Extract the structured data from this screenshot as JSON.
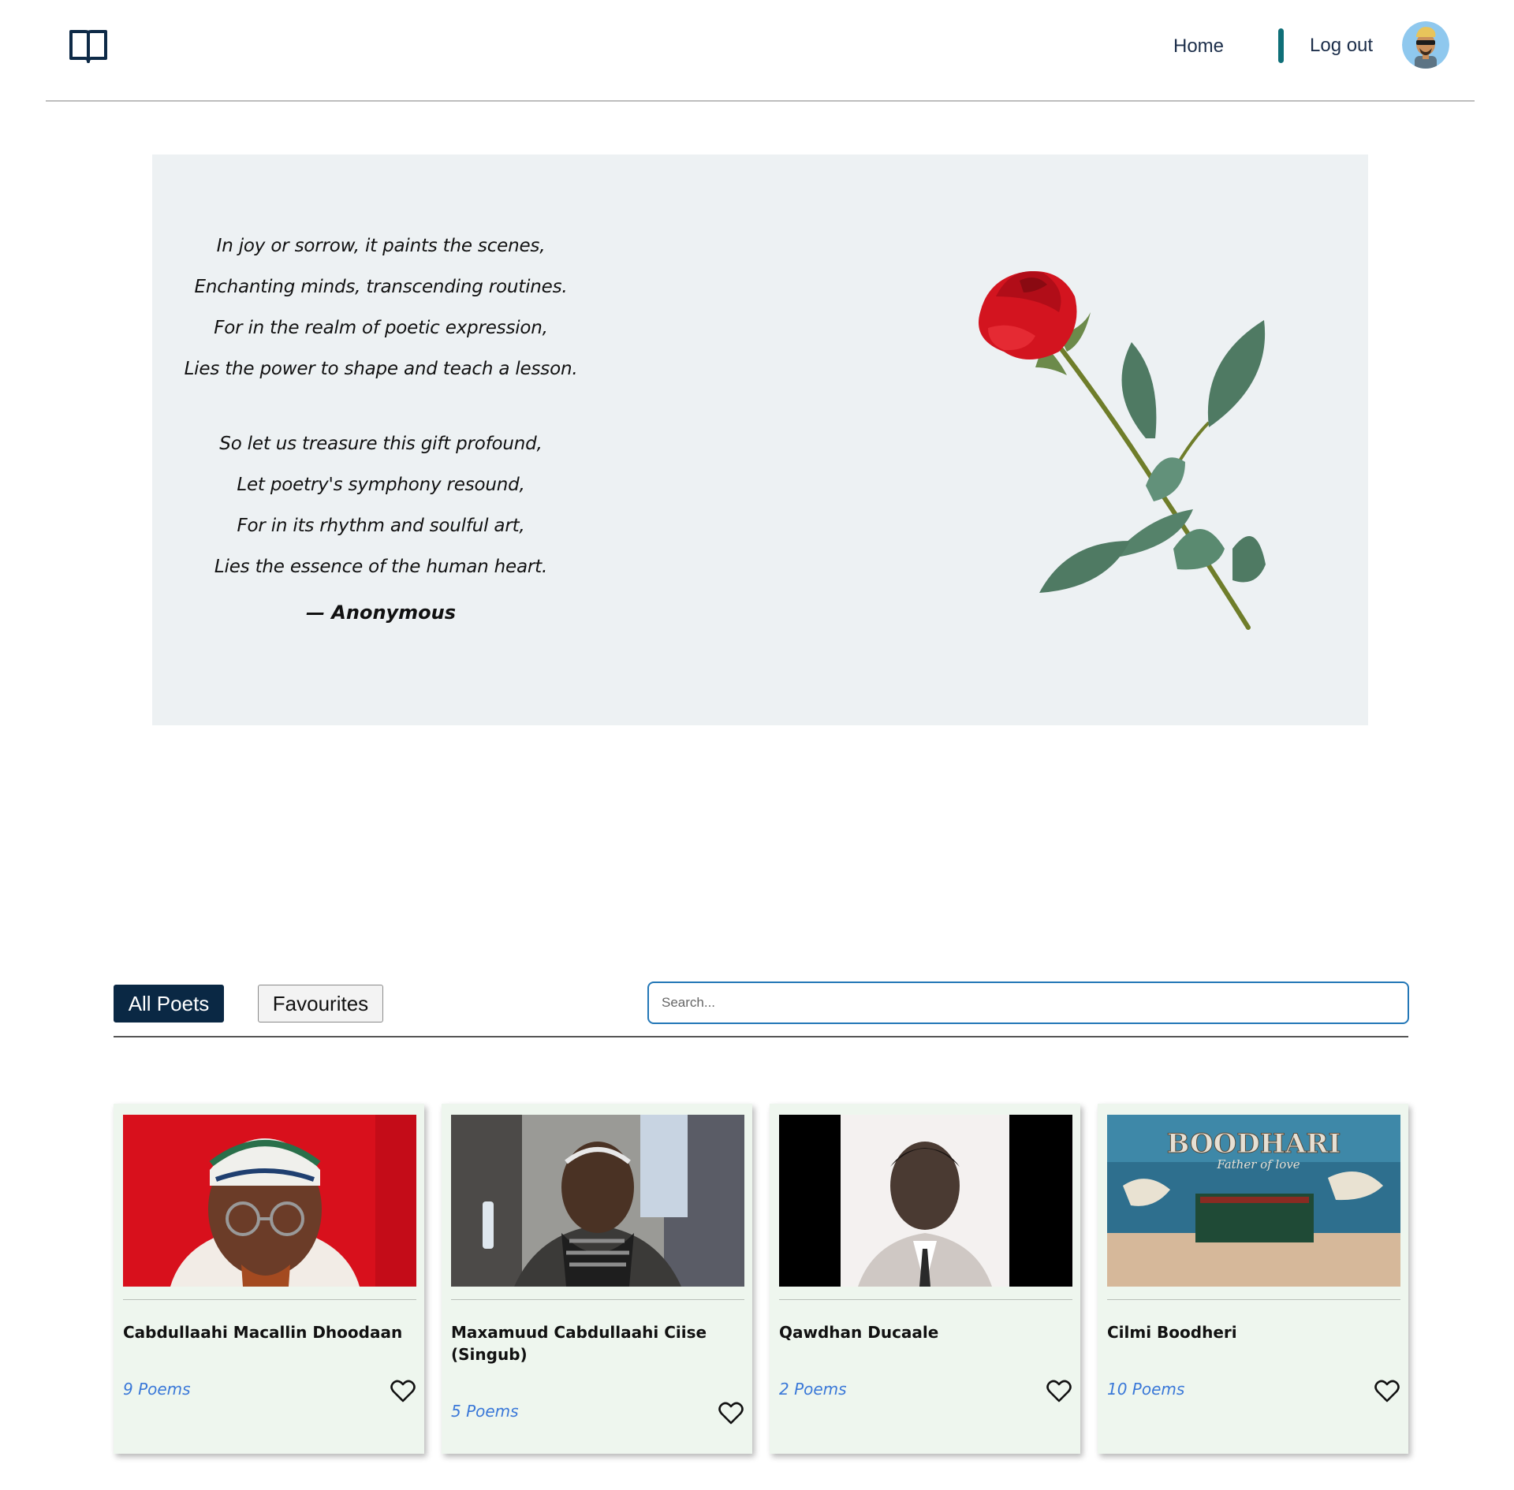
{
  "header": {
    "logo_icon": "open-book-icon",
    "nav": {
      "home": "Home",
      "logout": "Log out"
    },
    "accent_color": "#0f6f78",
    "avatar_icon": "user-avatar-icon"
  },
  "hero": {
    "background": "#edf1f3",
    "stanzas": [
      [
        "In joy or sorrow, it paints the scenes,",
        "Enchanting minds, transcending routines.",
        "For in the realm of poetic expression,",
        "Lies the power to shape and teach a lesson."
      ],
      [
        "So let us treasure this gift profound,",
        "Let poetry's symphony resound,",
        "For in its rhythm and soulful art,",
        "Lies the essence of the human heart."
      ]
    ],
    "author": "— Anonymous",
    "image_icon": "red-rose-image"
  },
  "filters": {
    "all_poets": "All Poets",
    "favourites": "Favourites",
    "active_tab": "All Poets",
    "search_placeholder": "Search..."
  },
  "poets": [
    {
      "name": "Cabdullaahi Macallin Dhoodaan",
      "poems": "9 Poems",
      "favourite_icon": "heart-outline-icon"
    },
    {
      "name": "Maxamuud Cabdullaahi Ciise (Singub)",
      "poems": "5 Poems",
      "favourite_icon": "heart-outline-icon"
    },
    {
      "name": "Qawdhan Ducaale",
      "poems": "2 Poems",
      "favourite_icon": "heart-outline-icon"
    },
    {
      "name": "Cilmi Boodheri",
      "poems": "10 Poems",
      "favourite_icon": "heart-outline-icon"
    }
  ],
  "card_photo_texts": {
    "mural_title": "BOODHARI",
    "mural_subtitle": "Father of love"
  }
}
